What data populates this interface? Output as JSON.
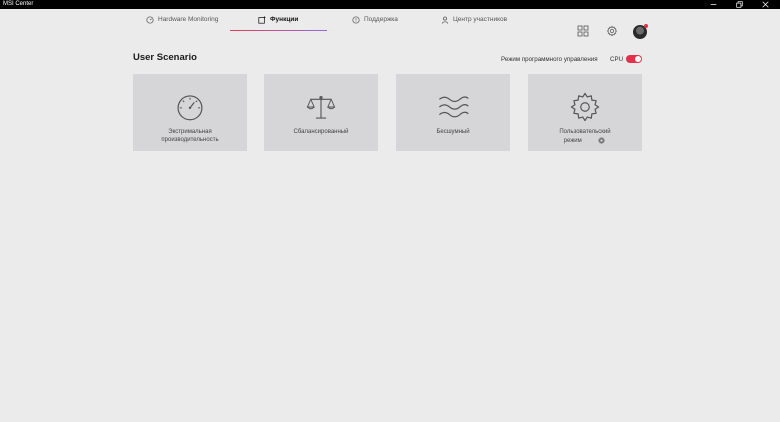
{
  "window": {
    "title": "MSI Center"
  },
  "nav": {
    "tabs": [
      {
        "label": "Hardware Monitoring",
        "icon": "gauge-icon"
      },
      {
        "label": "Функции",
        "icon": "features-icon"
      },
      {
        "label": "Поддержка",
        "icon": "support-icon"
      },
      {
        "label": "Центр участников",
        "icon": "user-icon"
      }
    ],
    "active_tab": "Функции"
  },
  "section": {
    "title": "User Scenario",
    "mode_label": "Режим программного управления",
    "cpu_label": "CPU",
    "toggle_on": true
  },
  "cards": [
    {
      "label_line1": "Экстримальная",
      "label_line2": "производительность",
      "icon": "speedometer-icon"
    },
    {
      "label": "Сбалансированный",
      "icon": "scales-icon"
    },
    {
      "label": "Бесшумный",
      "icon": "waves-icon"
    },
    {
      "label_line1": "Пользовательский",
      "label_line2": "режим",
      "icon": "cog-icon"
    }
  ],
  "colors": {
    "accent_red": "#e5304c",
    "accent_purple": "#8f6dd6",
    "card_bg": "#d6d6d9",
    "page_bg": "#ebebeb"
  }
}
